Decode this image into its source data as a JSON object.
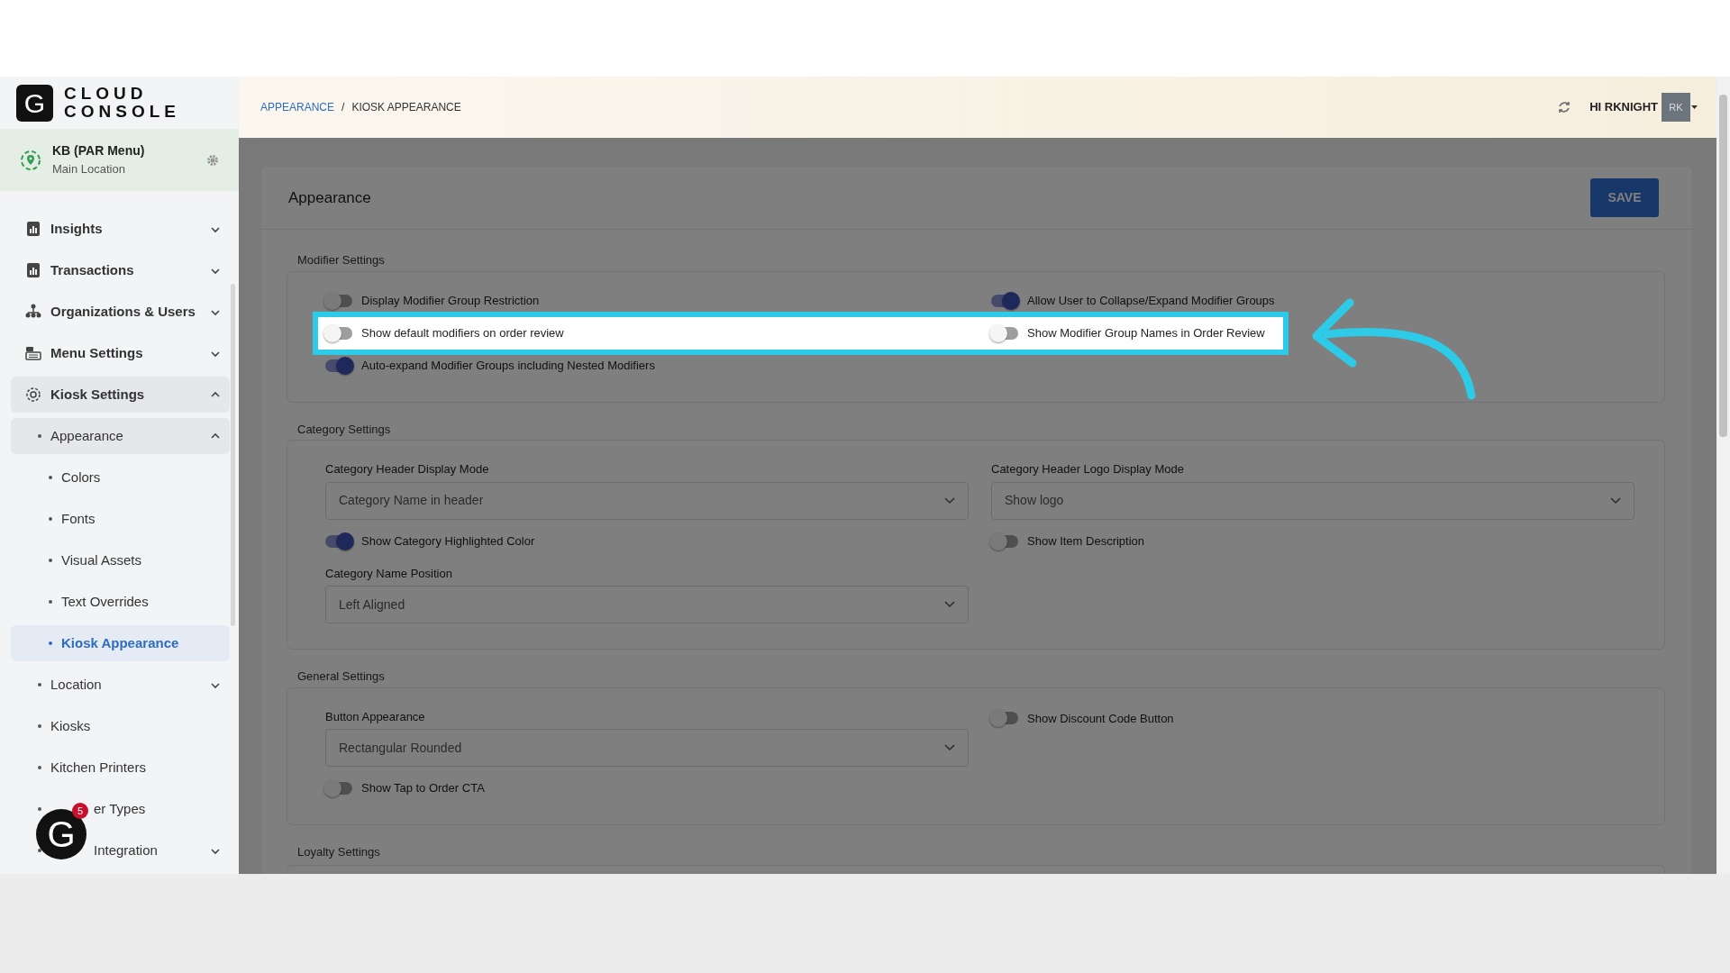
{
  "logo": {
    "mark": "G",
    "line1": "CLOUD",
    "line2": "CONSOLE"
  },
  "location": {
    "name": "KB (PAR Menu)",
    "subtitle": "Main Location"
  },
  "sidebar": {
    "items": [
      {
        "label": "Insights",
        "expanded": false,
        "selected": false
      },
      {
        "label": "Transactions",
        "expanded": false,
        "selected": false
      },
      {
        "label": "Organizations & Users",
        "expanded": false,
        "selected": false
      },
      {
        "label": "Menu Settings",
        "expanded": false,
        "selected": false
      },
      {
        "label": "Kiosk Settings",
        "expanded": true,
        "selected": false,
        "children": [
          {
            "label": "Appearance",
            "expanded": true,
            "selected": false,
            "children": [
              {
                "label": "Colors",
                "selected": false
              },
              {
                "label": "Fonts",
                "selected": false
              },
              {
                "label": "Visual Assets",
                "selected": false
              },
              {
                "label": "Text Overrides",
                "selected": false
              },
              {
                "label": "Kiosk Appearance",
                "selected": true
              }
            ]
          },
          {
            "label": "Location",
            "expanded": false,
            "selected": false
          },
          {
            "label": "Kiosks",
            "selected": false
          },
          {
            "label": "Kitchen Printers",
            "selected": false
          },
          {
            "label": "er Types",
            "selected": false
          },
          {
            "label": "Integration",
            "expanded": false,
            "selected": false
          }
        ]
      }
    ]
  },
  "help_widget": {
    "mark": "G",
    "badge": "5"
  },
  "breadcrumb": {
    "separator": "/",
    "items": [
      {
        "label": "APPEARANCE",
        "link": true
      },
      {
        "label": "KIOSK APPEARANCE",
        "link": false
      }
    ]
  },
  "user": {
    "greeting": "HI RKNIGHT",
    "avatar": "RK"
  },
  "page": {
    "title": "Appearance",
    "save_button": "SAVE"
  },
  "sections": [
    {
      "title": "Modifier Settings",
      "rows": [
        {
          "highlighted": false,
          "items": [
            {
              "kind": "toggle",
              "label": "Display Modifier Group Restriction",
              "on": false
            },
            {
              "kind": "toggle",
              "label": "Allow User to Collapse/Expand Modifier Groups",
              "on": true
            }
          ]
        },
        {
          "highlighted": true,
          "items": [
            {
              "kind": "toggle",
              "label": "Show default modifiers on order review",
              "on": false
            },
            {
              "kind": "toggle",
              "label": "Show Modifier Group Names in Order Review",
              "on": false
            }
          ]
        },
        {
          "highlighted": false,
          "items": [
            {
              "kind": "toggle",
              "label": "Auto-expand Modifier Groups including Nested Modifiers",
              "on": true
            }
          ]
        }
      ]
    },
    {
      "title": "Category Settings",
      "rows": [
        {
          "highlighted": false,
          "items": [
            {
              "kind": "select",
              "label": "Category Header Display Mode",
              "value": "Category Name in header"
            },
            {
              "kind": "select",
              "label": "Category Header Logo Display Mode",
              "value": "Show logo"
            }
          ]
        },
        {
          "highlighted": false,
          "items": [
            {
              "kind": "toggle",
              "label": "Show Category Highlighted Color",
              "on": true
            },
            {
              "kind": "toggle",
              "label": "Show Item Description",
              "on": false
            }
          ]
        },
        {
          "highlighted": false,
          "items": [
            {
              "kind": "select",
              "label": "Category Name Position",
              "value": "Left Aligned"
            }
          ]
        }
      ]
    },
    {
      "title": "General Settings",
      "rows": [
        {
          "highlighted": false,
          "items": [
            {
              "kind": "select",
              "label": "Button Appearance",
              "value": "Rectangular Rounded"
            },
            {
              "kind": "toggle",
              "label": "Show Discount Code Button",
              "on": false
            }
          ]
        },
        {
          "highlighted": false,
          "items": [
            {
              "kind": "toggle",
              "label": "Show Tap to Order CTA",
              "on": false
            }
          ]
        }
      ]
    },
    {
      "title": "Loyalty Settings"
    }
  ]
}
